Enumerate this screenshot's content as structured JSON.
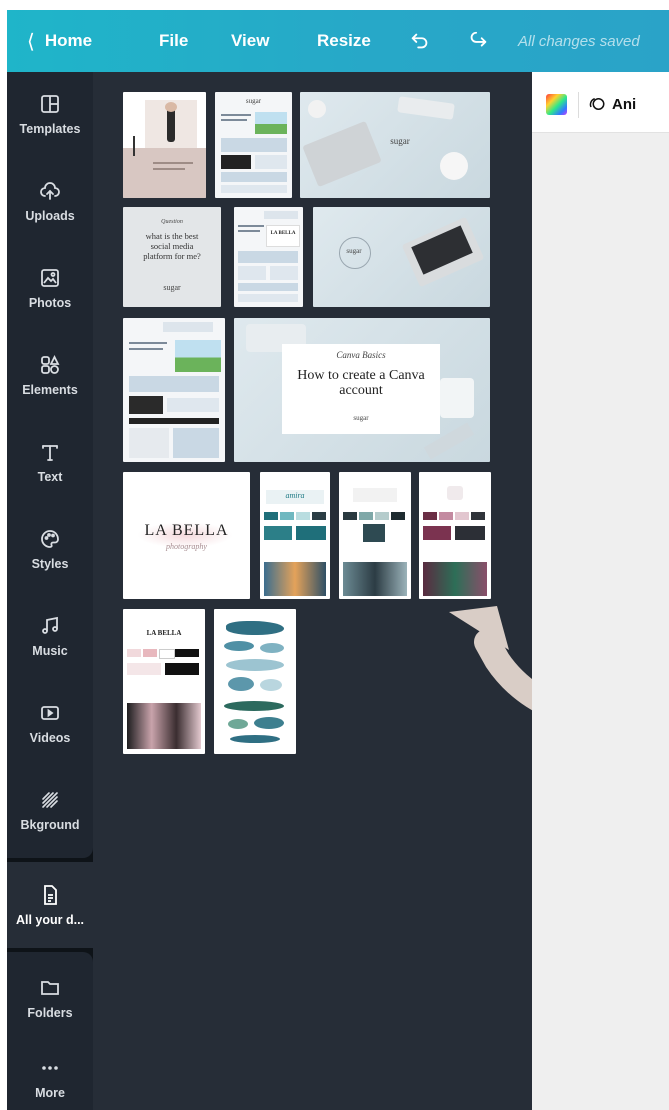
{
  "topbar": {
    "home_label": "Home",
    "file_label": "File",
    "view_label": "View",
    "resize_label": "Resize",
    "save_status": "All changes saved"
  },
  "sidebar": {
    "items": [
      {
        "label": "Templates",
        "icon": "templates-icon"
      },
      {
        "label": "Uploads",
        "icon": "upload-cloud-icon"
      },
      {
        "label": "Photos",
        "icon": "image-icon"
      },
      {
        "label": "Elements",
        "icon": "shapes-icon"
      },
      {
        "label": "Text",
        "icon": "text-icon"
      },
      {
        "label": "Styles",
        "icon": "palette-icon"
      },
      {
        "label": "Music",
        "icon": "music-note-icon"
      },
      {
        "label": "Videos",
        "icon": "video-icon"
      },
      {
        "label": "Bkground",
        "icon": "background-icon"
      },
      {
        "label": "All your d...",
        "icon": "document-icon"
      },
      {
        "label": "Folders",
        "icon": "folder-icon"
      },
      {
        "label": "More",
        "icon": "more-dots-icon"
      }
    ]
  },
  "thumbnails": {
    "t1": {
      "brand": "sugar"
    },
    "t3": {
      "brand": "sugar"
    },
    "t4": {
      "kicker": "Question",
      "text": "what is the best social media platform for me?",
      "brand": "sugar"
    },
    "t5": {
      "brand": "LA BELLA"
    },
    "t6": {
      "brand": "sugar"
    },
    "t8": {
      "kicker": "Canva Basics",
      "title": "How to create a Canva account",
      "brand": "sugar"
    },
    "t9": {
      "title": "LA BELLA",
      "sub": "photography"
    },
    "t10": {
      "brand": "amira"
    },
    "t13": {
      "brand": "LA BELLA"
    }
  },
  "canvas": {
    "animate_label": "Ani"
  },
  "colors": {
    "topbar": "#1fb5c9",
    "sidebar": "#1f2630",
    "panel": "#262d37",
    "arrow": "#d9cdc6"
  }
}
